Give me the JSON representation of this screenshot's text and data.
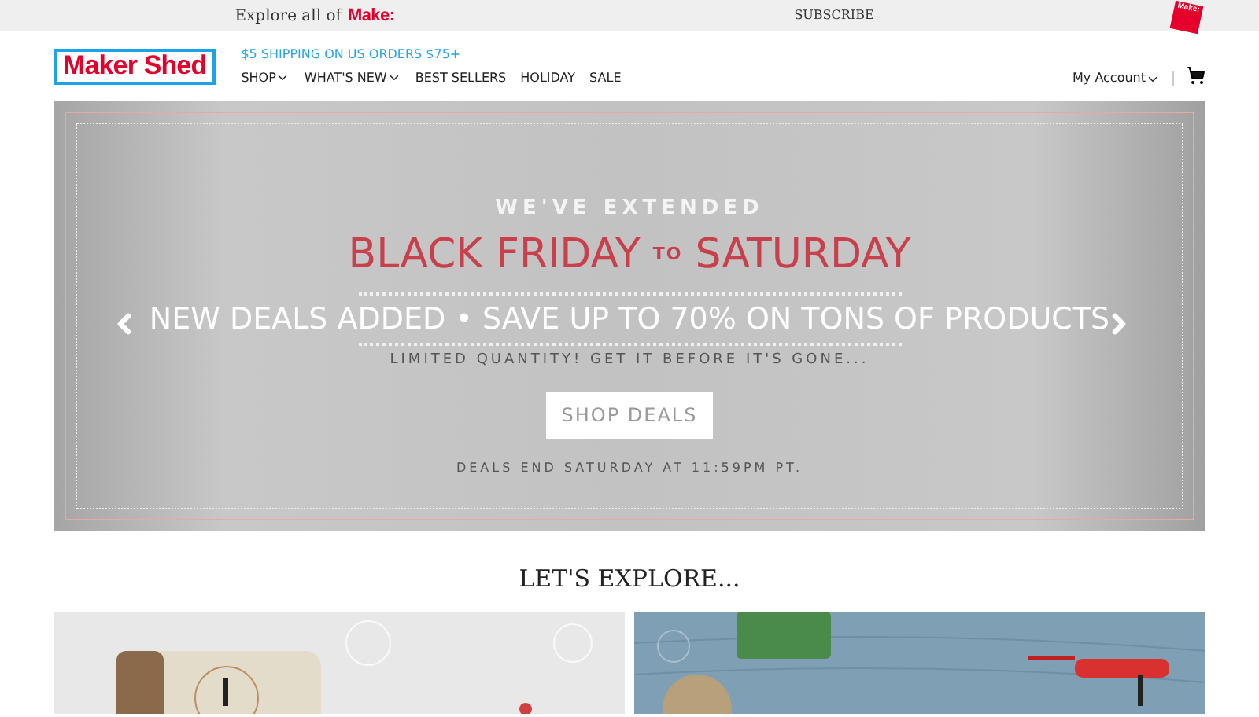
{
  "top_bar": {
    "explore_text": "Explore all of",
    "brand": "Make:",
    "subscribe": "SUBSCRIBE",
    "badge": "Make:"
  },
  "header": {
    "logo": "Maker Shed",
    "promo": "$5 SHIPPING ON US ORDERS $75+",
    "nav": [
      {
        "label": "SHOP",
        "dropdown": true
      },
      {
        "label": "WHAT'S NEW",
        "dropdown": true
      },
      {
        "label": "BEST SELLERS",
        "dropdown": false
      },
      {
        "label": "HOLIDAY",
        "dropdown": false
      },
      {
        "label": "SALE",
        "dropdown": false
      }
    ],
    "account": "My Account"
  },
  "banner": {
    "kicker": "WE'VE EXTENDED",
    "headline_1": "BLACK FRIDAY",
    "headline_to": "TO",
    "headline_2": "SATURDAY",
    "deals": "NEW DEALS ADDED • SAVE UP TO 70% ON TONS OF PRODUCTS",
    "limited": "LIMITED QUANTITY! GET IT BEFORE IT'S GONE...",
    "button": "SHOP DEALS",
    "ends": "DEALS END SATURDAY AT 11:59PM PT."
  },
  "explore": {
    "title": "LET'S EXPLORE..."
  }
}
